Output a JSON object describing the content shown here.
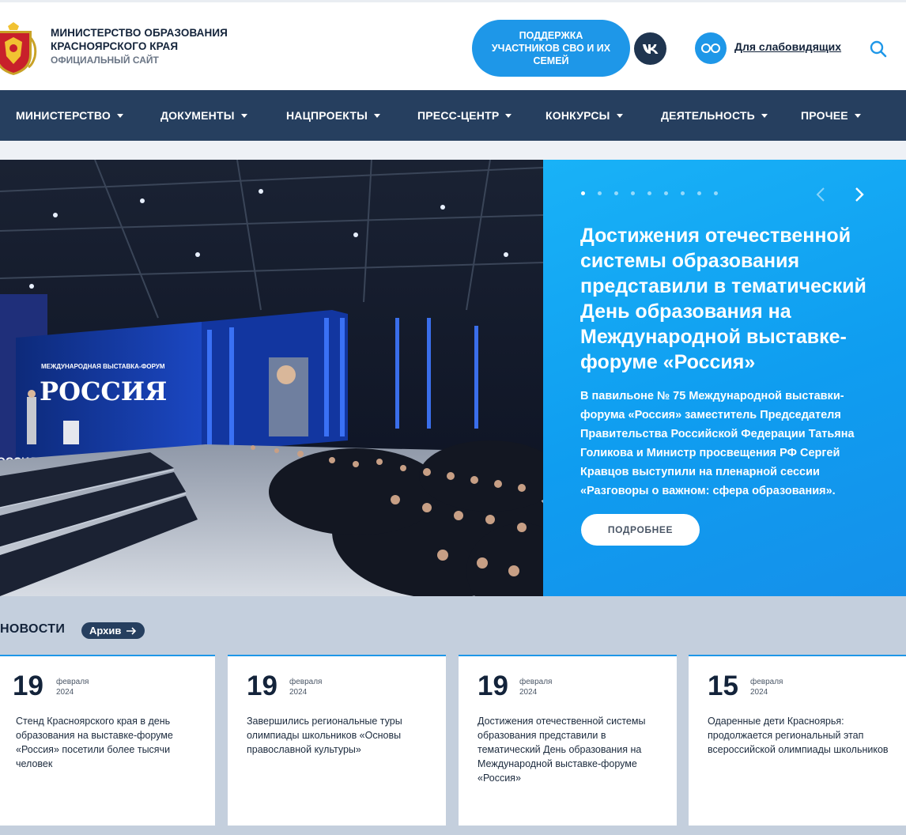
{
  "header": {
    "title_line1": "МИНИСТЕРСТВО ОБРАЗОВАНИЯ",
    "title_line2": "КРАСНОЯРСКОГО КРАЯ",
    "subtitle": "ОФИЦИАЛЬНЫЙ САЙТ",
    "support_button": "ПОДДЕРЖКА УЧАСТНИКОВ СВО И ИХ СЕМЕЙ",
    "vk_label": "VK",
    "vision_link": "Для слабовидящих",
    "icons": [
      "coat-of-arms-logo",
      "vk-icon",
      "glasses-icon",
      "search-icon"
    ]
  },
  "nav": {
    "items": [
      {
        "label": "МИНИСТЕРСТВО"
      },
      {
        "label": "ДОКУМЕНТЫ"
      },
      {
        "label": "НАЦПРОЕКТЫ"
      },
      {
        "label": "ПРЕСС-ЦЕНТР"
      },
      {
        "label": "КОНКУРСЫ"
      },
      {
        "label": "ДЕЯТЕЛЬНОСТЬ"
      },
      {
        "label": "ПРОЧЕЕ"
      }
    ]
  },
  "slider": {
    "total_slides": 9,
    "active_slide": 1,
    "title": "Достижения отечественной системы образования представили в тематический День образования на Международной выставке-форуме «Россия»",
    "text": "В павильоне № 75 Международной выставки-форума «Россия» заместитель Председателя Правительства Российской Федерации Татьяна Голикова и Министр просвещения РФ Сергей Кравцов выступили на пленарной сессии «Разговоры о важном: сфера образования».",
    "more_button": "ПОДРОБНЕЕ",
    "image_caption_line1": "МЕЖДУНАРОДНАЯ ВЫСТАВКА-ФОРУМ",
    "image_caption_line2": "РОССИЯ",
    "image_side_sign": "ОССИЯ"
  },
  "news": {
    "heading": "НОВОСТИ",
    "archive_button": "Архив",
    "items": [
      {
        "day": "19",
        "month": "февраля",
        "year": "2024",
        "text": "Стенд Красноярского края в день образования на выставке-форуме «Россия» посетили более тысячи человек"
      },
      {
        "day": "19",
        "month": "февраля",
        "year": "2024",
        "text": "Завершились региональные туры олимпиады школьников «Основы православной культуры»"
      },
      {
        "day": "19",
        "month": "февраля",
        "year": "2024",
        "text": "Достижения отечественной системы образования представили в тематический День образования на Международной выставке-форуме «Россия»"
      },
      {
        "day": "15",
        "month": "февраля",
        "year": "2024",
        "text": "Одаренные дети Красноярья: продолжается региональный этап всероссийской олимпиады школьников"
      }
    ]
  },
  "colors": {
    "nav_bg": "#263f5f",
    "accent_blue": "#1e97e8",
    "slide_panel": "#12a4f3",
    "news_band": "#c4cfdd"
  }
}
